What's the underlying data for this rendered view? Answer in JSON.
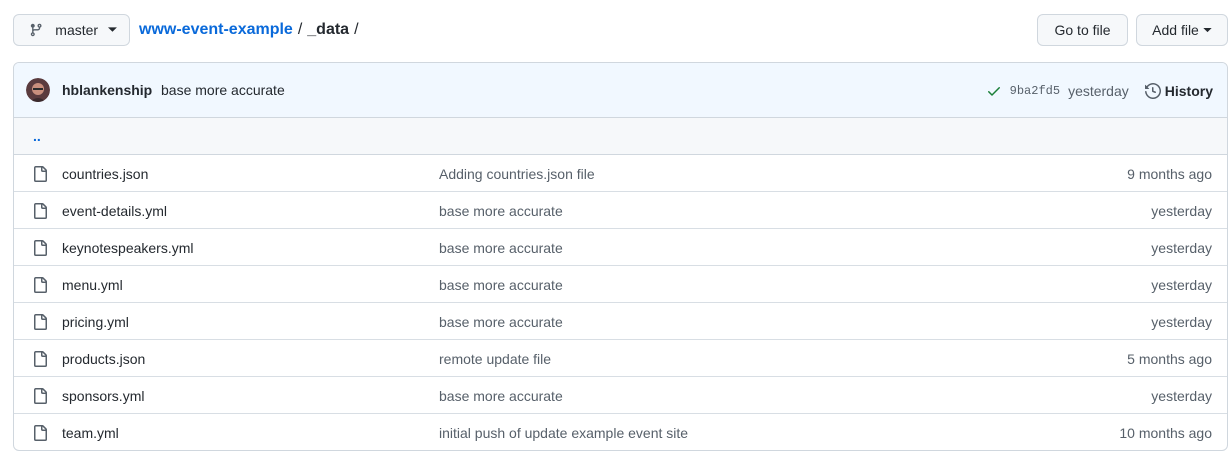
{
  "branch": {
    "name": "master"
  },
  "breadcrumb": {
    "repo": "www-event-example",
    "sep1": "/",
    "dir": "_data",
    "sep2": "/"
  },
  "actions": {
    "go_to_file": "Go to file",
    "add_file": "Add file"
  },
  "commit": {
    "author": "hblankenship",
    "message": "base more accurate",
    "sha": "9ba2fd5",
    "when": "yesterday",
    "history_label": "History"
  },
  "parent_dir": {
    "label": ".."
  },
  "files": [
    {
      "name": "countries.json",
      "message": "Adding countries.json file",
      "age": "9 months ago"
    },
    {
      "name": "event-details.yml",
      "message": "base more accurate",
      "age": "yesterday"
    },
    {
      "name": "keynotespeakers.yml",
      "message": "base more accurate",
      "age": "yesterday"
    },
    {
      "name": "menu.yml",
      "message": "base more accurate",
      "age": "yesterday"
    },
    {
      "name": "pricing.yml",
      "message": "base more accurate",
      "age": "yesterday"
    },
    {
      "name": "products.json",
      "message": "remote update file",
      "age": "5 months ago"
    },
    {
      "name": "sponsors.yml",
      "message": "base more accurate",
      "age": "yesterday"
    },
    {
      "name": "team.yml",
      "message": "initial push of update example event site",
      "age": "10 months ago"
    }
  ],
  "colors": {
    "link": "#0969da",
    "success": "#1a7f37",
    "muted": "#57606a",
    "border": "#d0d7de"
  },
  "icons": {
    "branch": "git-branch-icon",
    "file": "file-icon",
    "history": "history-icon",
    "check": "check-icon"
  }
}
